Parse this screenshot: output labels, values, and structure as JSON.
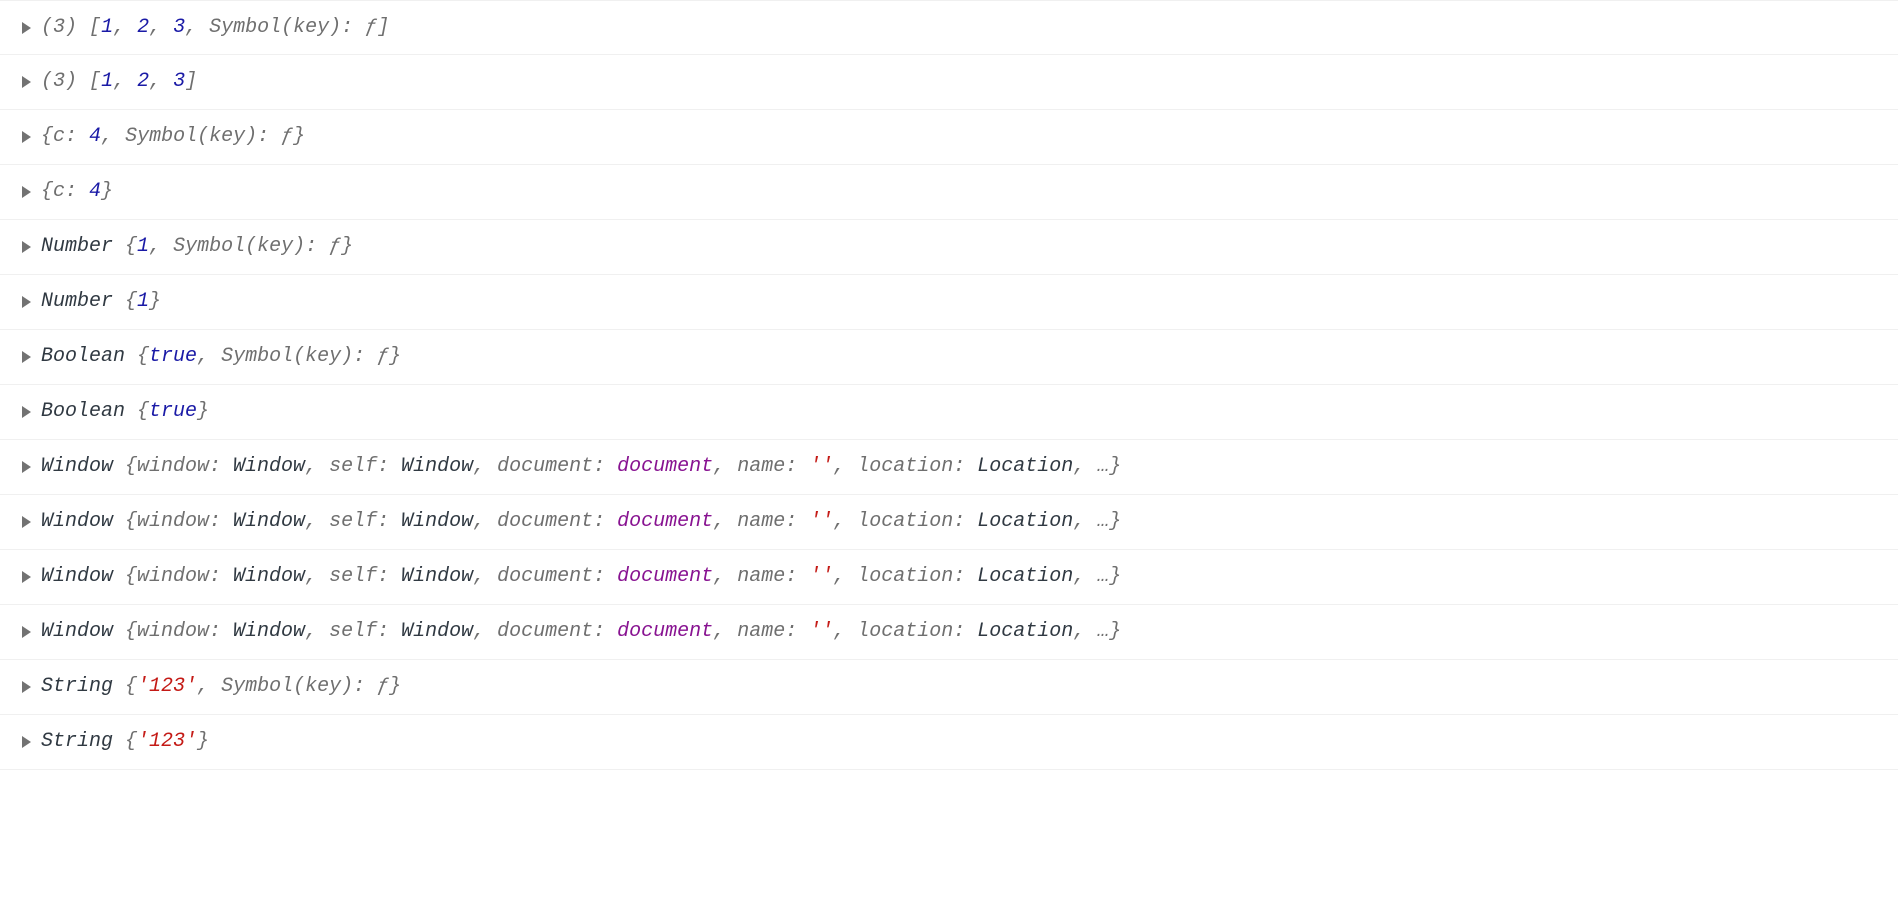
{
  "rows": [
    {
      "tokens": [
        {
          "text": "(",
          "cls": "t-dim"
        },
        {
          "text": "3",
          "cls": "t-dim"
        },
        {
          "text": ") ",
          "cls": "t-dim"
        },
        {
          "text": "[",
          "cls": "t-dim"
        },
        {
          "text": "1",
          "cls": "t-num"
        },
        {
          "text": ", ",
          "cls": "t-dim"
        },
        {
          "text": "2",
          "cls": "t-num"
        },
        {
          "text": ", ",
          "cls": "t-dim"
        },
        {
          "text": "3",
          "cls": "t-num"
        },
        {
          "text": ", ",
          "cls": "t-dim"
        },
        {
          "text": "Symbol(key): ",
          "cls": "t-dim"
        },
        {
          "text": "ƒ",
          "cls": "t-fn"
        },
        {
          "text": "]",
          "cls": "t-dim"
        }
      ]
    },
    {
      "tokens": [
        {
          "text": "(",
          "cls": "t-dim"
        },
        {
          "text": "3",
          "cls": "t-dim"
        },
        {
          "text": ") ",
          "cls": "t-dim"
        },
        {
          "text": "[",
          "cls": "t-dim"
        },
        {
          "text": "1",
          "cls": "t-num"
        },
        {
          "text": ", ",
          "cls": "t-dim"
        },
        {
          "text": "2",
          "cls": "t-num"
        },
        {
          "text": ", ",
          "cls": "t-dim"
        },
        {
          "text": "3",
          "cls": "t-num"
        },
        {
          "text": "]",
          "cls": "t-dim"
        }
      ]
    },
    {
      "tokens": [
        {
          "text": "{",
          "cls": "t-dim"
        },
        {
          "text": "c: ",
          "cls": "t-dim"
        },
        {
          "text": "4",
          "cls": "t-num"
        },
        {
          "text": ", ",
          "cls": "t-dim"
        },
        {
          "text": "Symbol(key): ",
          "cls": "t-dim"
        },
        {
          "text": "ƒ",
          "cls": "t-fn"
        },
        {
          "text": "}",
          "cls": "t-dim"
        }
      ]
    },
    {
      "tokens": [
        {
          "text": "{",
          "cls": "t-dim"
        },
        {
          "text": "c: ",
          "cls": "t-dim"
        },
        {
          "text": "4",
          "cls": "t-num"
        },
        {
          "text": "}",
          "cls": "t-dim"
        }
      ]
    },
    {
      "tokens": [
        {
          "text": "Number ",
          "cls": "t-type"
        },
        {
          "text": "{",
          "cls": "t-dim"
        },
        {
          "text": "1",
          "cls": "t-num"
        },
        {
          "text": ", ",
          "cls": "t-dim"
        },
        {
          "text": "Symbol(key): ",
          "cls": "t-dim"
        },
        {
          "text": "ƒ",
          "cls": "t-fn"
        },
        {
          "text": "}",
          "cls": "t-dim"
        }
      ]
    },
    {
      "tokens": [
        {
          "text": "Number ",
          "cls": "t-type"
        },
        {
          "text": "{",
          "cls": "t-dim"
        },
        {
          "text": "1",
          "cls": "t-num"
        },
        {
          "text": "}",
          "cls": "t-dim"
        }
      ]
    },
    {
      "tokens": [
        {
          "text": "Boolean ",
          "cls": "t-type"
        },
        {
          "text": "{",
          "cls": "t-dim"
        },
        {
          "text": "true",
          "cls": "t-bool"
        },
        {
          "text": ", ",
          "cls": "t-dim"
        },
        {
          "text": "Symbol(key): ",
          "cls": "t-dim"
        },
        {
          "text": "ƒ",
          "cls": "t-fn"
        },
        {
          "text": "}",
          "cls": "t-dim"
        }
      ]
    },
    {
      "tokens": [
        {
          "text": "Boolean ",
          "cls": "t-type"
        },
        {
          "text": "{",
          "cls": "t-dim"
        },
        {
          "text": "true",
          "cls": "t-bool"
        },
        {
          "text": "}",
          "cls": "t-dim"
        }
      ]
    },
    {
      "tokens": [
        {
          "text": "Window ",
          "cls": "t-type"
        },
        {
          "text": "{",
          "cls": "t-dim"
        },
        {
          "text": "window: ",
          "cls": "t-dim"
        },
        {
          "text": "Window",
          "cls": "t-type"
        },
        {
          "text": ", ",
          "cls": "t-dim"
        },
        {
          "text": "self: ",
          "cls": "t-dim"
        },
        {
          "text": "Window",
          "cls": "t-type"
        },
        {
          "text": ", ",
          "cls": "t-dim"
        },
        {
          "text": "document: ",
          "cls": "t-dim"
        },
        {
          "text": "document",
          "cls": "t-doc"
        },
        {
          "text": ", ",
          "cls": "t-dim"
        },
        {
          "text": "name: ",
          "cls": "t-dim"
        },
        {
          "text": "''",
          "cls": "t-str"
        },
        {
          "text": ", ",
          "cls": "t-dim"
        },
        {
          "text": "location: ",
          "cls": "t-dim"
        },
        {
          "text": "Location",
          "cls": "t-type"
        },
        {
          "text": ", …}",
          "cls": "t-dim"
        }
      ]
    },
    {
      "tokens": [
        {
          "text": "Window ",
          "cls": "t-type"
        },
        {
          "text": "{",
          "cls": "t-dim"
        },
        {
          "text": "window: ",
          "cls": "t-dim"
        },
        {
          "text": "Window",
          "cls": "t-type"
        },
        {
          "text": ", ",
          "cls": "t-dim"
        },
        {
          "text": "self: ",
          "cls": "t-dim"
        },
        {
          "text": "Window",
          "cls": "t-type"
        },
        {
          "text": ", ",
          "cls": "t-dim"
        },
        {
          "text": "document: ",
          "cls": "t-dim"
        },
        {
          "text": "document",
          "cls": "t-doc"
        },
        {
          "text": ", ",
          "cls": "t-dim"
        },
        {
          "text": "name: ",
          "cls": "t-dim"
        },
        {
          "text": "''",
          "cls": "t-str"
        },
        {
          "text": ", ",
          "cls": "t-dim"
        },
        {
          "text": "location: ",
          "cls": "t-dim"
        },
        {
          "text": "Location",
          "cls": "t-type"
        },
        {
          "text": ", …}",
          "cls": "t-dim"
        }
      ]
    },
    {
      "tokens": [
        {
          "text": "Window ",
          "cls": "t-type"
        },
        {
          "text": "{",
          "cls": "t-dim"
        },
        {
          "text": "window: ",
          "cls": "t-dim"
        },
        {
          "text": "Window",
          "cls": "t-type"
        },
        {
          "text": ", ",
          "cls": "t-dim"
        },
        {
          "text": "self: ",
          "cls": "t-dim"
        },
        {
          "text": "Window",
          "cls": "t-type"
        },
        {
          "text": ", ",
          "cls": "t-dim"
        },
        {
          "text": "document: ",
          "cls": "t-dim"
        },
        {
          "text": "document",
          "cls": "t-doc"
        },
        {
          "text": ", ",
          "cls": "t-dim"
        },
        {
          "text": "name: ",
          "cls": "t-dim"
        },
        {
          "text": "''",
          "cls": "t-str"
        },
        {
          "text": ", ",
          "cls": "t-dim"
        },
        {
          "text": "location: ",
          "cls": "t-dim"
        },
        {
          "text": "Location",
          "cls": "t-type"
        },
        {
          "text": ", …}",
          "cls": "t-dim"
        }
      ]
    },
    {
      "tokens": [
        {
          "text": "Window ",
          "cls": "t-type"
        },
        {
          "text": "{",
          "cls": "t-dim"
        },
        {
          "text": "window: ",
          "cls": "t-dim"
        },
        {
          "text": "Window",
          "cls": "t-type"
        },
        {
          "text": ", ",
          "cls": "t-dim"
        },
        {
          "text": "self: ",
          "cls": "t-dim"
        },
        {
          "text": "Window",
          "cls": "t-type"
        },
        {
          "text": ", ",
          "cls": "t-dim"
        },
        {
          "text": "document: ",
          "cls": "t-dim"
        },
        {
          "text": "document",
          "cls": "t-doc"
        },
        {
          "text": ", ",
          "cls": "t-dim"
        },
        {
          "text": "name: ",
          "cls": "t-dim"
        },
        {
          "text": "''",
          "cls": "t-str"
        },
        {
          "text": ", ",
          "cls": "t-dim"
        },
        {
          "text": "location: ",
          "cls": "t-dim"
        },
        {
          "text": "Location",
          "cls": "t-type"
        },
        {
          "text": ", …}",
          "cls": "t-dim"
        }
      ]
    },
    {
      "tokens": [
        {
          "text": "String ",
          "cls": "t-type"
        },
        {
          "text": "{",
          "cls": "t-dim"
        },
        {
          "text": "'123'",
          "cls": "t-str"
        },
        {
          "text": ", ",
          "cls": "t-dim"
        },
        {
          "text": "Symbol(key): ",
          "cls": "t-dim"
        },
        {
          "text": "ƒ",
          "cls": "t-fn"
        },
        {
          "text": "}",
          "cls": "t-dim"
        }
      ]
    },
    {
      "tokens": [
        {
          "text": "String ",
          "cls": "t-type"
        },
        {
          "text": "{",
          "cls": "t-dim"
        },
        {
          "text": "'123'",
          "cls": "t-str"
        },
        {
          "text": "}",
          "cls": "t-dim"
        }
      ]
    }
  ]
}
